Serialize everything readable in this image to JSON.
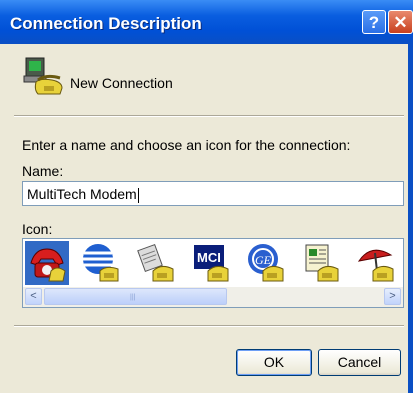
{
  "window": {
    "title": "Connection Description",
    "help_button": "?",
    "close_button": "✕"
  },
  "connection": {
    "name": "New Connection",
    "icon": "phone-modem-icon"
  },
  "prompt": "Enter a name and choose an icon for the connection:",
  "name_field": {
    "label": "Name:",
    "value": "MultiTech Modem"
  },
  "icon_picker": {
    "label": "Icon:",
    "icons": [
      "red-phone-icon",
      "globe-phone-icon",
      "fax-phone-icon",
      "mci-phone-icon",
      "ge-phone-icon",
      "document-phone-icon",
      "umbrella-phone-icon"
    ],
    "selected_index": 0,
    "scroll_left": "<",
    "scroll_right": ">"
  },
  "buttons": {
    "ok": "OK",
    "cancel": "Cancel"
  },
  "colors": {
    "title_bar": "#0050d6",
    "dialog_bg": "#ece9d8",
    "selection": "#316ac5"
  }
}
